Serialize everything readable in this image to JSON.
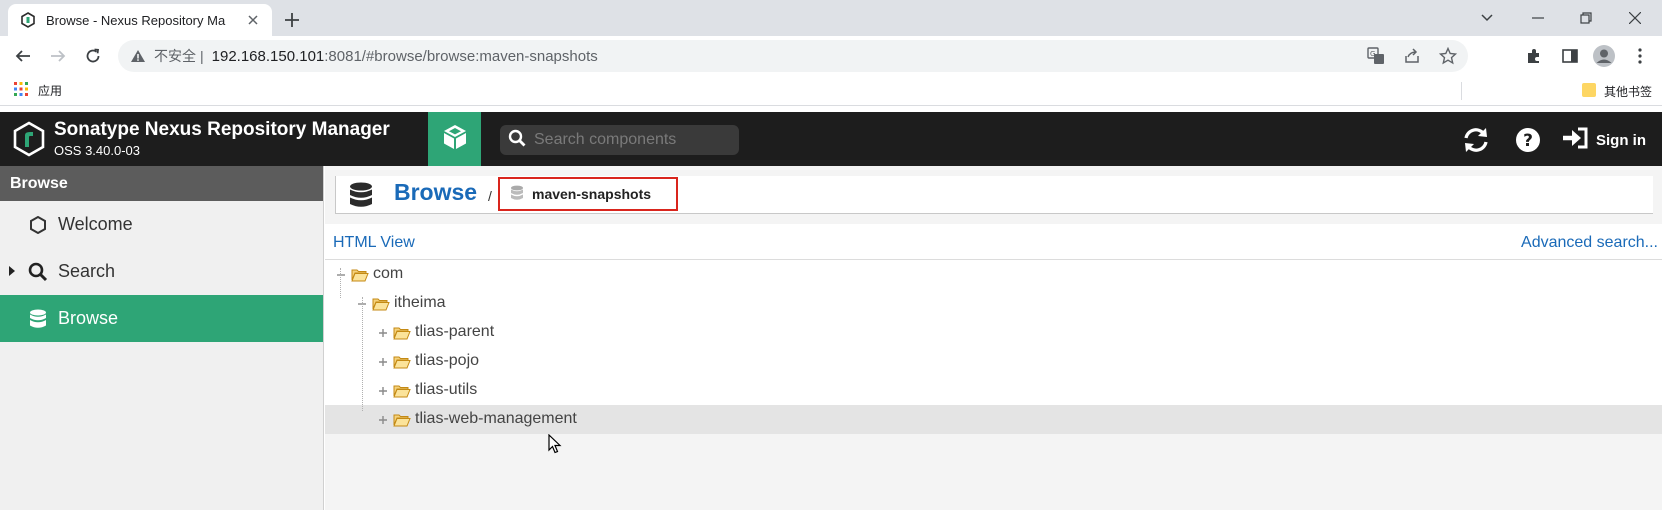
{
  "browser": {
    "tab_title": "Browse - Nexus Repository Ma",
    "url_insecure_label": "不安全",
    "url_separator": "|",
    "url_host": "192.168.150.101",
    "url_rest": ":8081/#browse/browse:maven-snapshots",
    "bookmark_apps": "应用",
    "bookmark_other": "其他书签"
  },
  "header": {
    "app_title": "Sonatype Nexus Repository Manager",
    "version": "OSS 3.40.0-03",
    "search_placeholder": "Search components",
    "sign_in": "Sign in"
  },
  "sidebar": {
    "heading": "Browse",
    "items": [
      {
        "label": "Welcome",
        "icon": "hexagon-icon"
      },
      {
        "label": "Search",
        "icon": "search-icon"
      },
      {
        "label": "Browse",
        "icon": "database-icon",
        "active": true
      }
    ]
  },
  "breadcrumb": {
    "title": "Browse",
    "separator": "/",
    "repository": "maven-snapshots"
  },
  "view_links": {
    "html_view": "HTML View",
    "advanced_search": "Advanced search..."
  },
  "tree": [
    {
      "label": "com",
      "level": 0,
      "toggle": "minus"
    },
    {
      "label": "itheima",
      "level": 1,
      "toggle": "minus"
    },
    {
      "label": "tlias-parent",
      "level": 2,
      "toggle": "plus"
    },
    {
      "label": "tlias-pojo",
      "level": 2,
      "toggle": "plus"
    },
    {
      "label": "tlias-utils",
      "level": 2,
      "toggle": "plus"
    },
    {
      "label": "tlias-web-management",
      "level": 2,
      "toggle": "plus",
      "hover": true
    }
  ],
  "colors": {
    "accent_green": "#2ea576",
    "header_dark": "#1d1d1d",
    "link_blue": "#1a6ab8",
    "highlight_red": "#d9251d"
  }
}
